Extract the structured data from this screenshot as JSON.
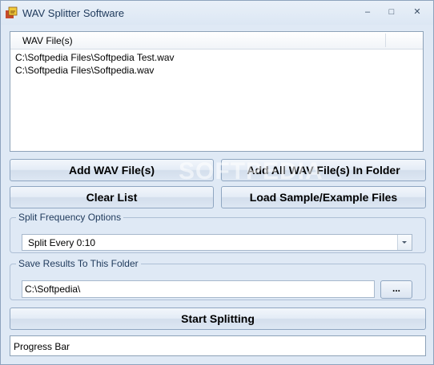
{
  "window": {
    "title": "WAV Splitter Software",
    "minimize": "–",
    "maximize": "□",
    "close": "✕"
  },
  "file_list": {
    "column_header": "WAV File(s)",
    "items": [
      "C:\\Softpedia Files\\Softpedia Test.wav",
      "C:\\Softpedia Files\\Softpedia.wav"
    ]
  },
  "buttons": {
    "add_files": "Add WAV File(s)",
    "add_folder": "Add All WAV File(s) In Folder",
    "clear_list": "Clear List",
    "load_sample": "Load Sample/Example Files",
    "start": "Start Splitting",
    "browse": "..."
  },
  "split_options": {
    "label": "Split Frequency Options",
    "selected": "Split Every 0:10"
  },
  "save_folder": {
    "label": "Save Results To This Folder",
    "value": "C:\\Softpedia\\"
  },
  "progress": {
    "label": "Progress Bar",
    "value": 0
  },
  "watermark": "SOFTPEDIA"
}
